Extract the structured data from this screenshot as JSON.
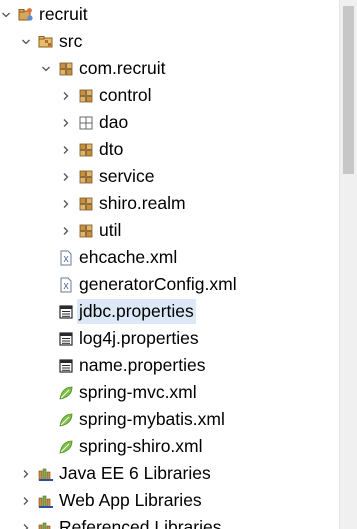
{
  "tree": {
    "items": [
      {
        "label": "recruit",
        "icon": "project-icon",
        "arrow": "expanded",
        "level": 0
      },
      {
        "label": "src",
        "icon": "source-folder-icon",
        "arrow": "expanded",
        "level": 1
      },
      {
        "label": "com.recruit",
        "icon": "package-icon",
        "arrow": "expanded",
        "level": 2
      },
      {
        "label": "control",
        "icon": "package-icon",
        "arrow": "collapsed",
        "level": 3
      },
      {
        "label": "dao",
        "icon": "empty-package-icon",
        "arrow": "collapsed",
        "level": 3
      },
      {
        "label": "dto",
        "icon": "package-icon",
        "arrow": "collapsed",
        "level": 3
      },
      {
        "label": "service",
        "icon": "package-icon",
        "arrow": "collapsed",
        "level": 3
      },
      {
        "label": "shiro.realm",
        "icon": "package-icon",
        "arrow": "collapsed",
        "level": 3
      },
      {
        "label": "util",
        "icon": "package-icon",
        "arrow": "collapsed",
        "level": 3
      },
      {
        "label": "ehcache.xml",
        "icon": "xml-file-icon",
        "arrow": "none",
        "level": 2
      },
      {
        "label": "generatorConfig.xml",
        "icon": "xml-file-icon",
        "arrow": "none",
        "level": 2
      },
      {
        "label": "jdbc.properties",
        "icon": "properties-file-icon",
        "arrow": "none",
        "level": 2,
        "selected": true
      },
      {
        "label": "log4j.properties",
        "icon": "properties-file-icon",
        "arrow": "none",
        "level": 2
      },
      {
        "label": "name.properties",
        "icon": "properties-file-icon",
        "arrow": "none",
        "level": 2
      },
      {
        "label": "spring-mvc.xml",
        "icon": "spring-config-icon",
        "arrow": "none",
        "level": 2
      },
      {
        "label": "spring-mybatis.xml",
        "icon": "spring-config-icon",
        "arrow": "none",
        "level": 2
      },
      {
        "label": "spring-shiro.xml",
        "icon": "spring-config-icon",
        "arrow": "none",
        "level": 2
      },
      {
        "label": "Java EE 6 Libraries",
        "icon": "library-icon",
        "arrow": "collapsed",
        "level": 1
      },
      {
        "label": "Web App Libraries",
        "icon": "library-icon",
        "arrow": "collapsed",
        "level": 1
      },
      {
        "label": "Referenced Libraries",
        "icon": "library-icon",
        "arrow": "collapsed",
        "level": 1
      }
    ]
  },
  "colors": {
    "selection": "#dde8f6",
    "package": "#c8903c",
    "library": "#7a5a2a",
    "spring": "#7cc244",
    "arrow": "#555555"
  }
}
